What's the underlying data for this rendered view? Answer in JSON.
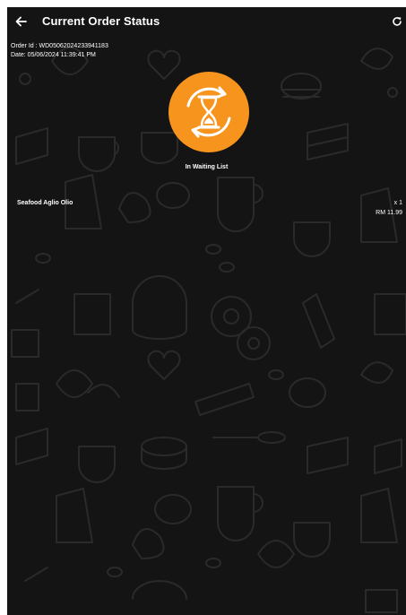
{
  "header": {
    "title": "Current Order Status",
    "back_icon": "arrow-left-icon",
    "refresh_icon": "refresh-icon"
  },
  "order": {
    "id_line": "Order Id : WD050620242339411​83",
    "date_line": "Date: 05/06/2024 11:39:41 PM"
  },
  "status": {
    "icon": "hourglass-icon",
    "label": "In Waiting List",
    "accent_color": "#F7941D"
  },
  "items": [
    {
      "name": "Seafood Aglio Olio",
      "quantity": "x 1",
      "price": "RM 11.99"
    }
  ],
  "theme": {
    "background": "#141414",
    "text": "#FFFFFF",
    "pattern": "#252525"
  }
}
